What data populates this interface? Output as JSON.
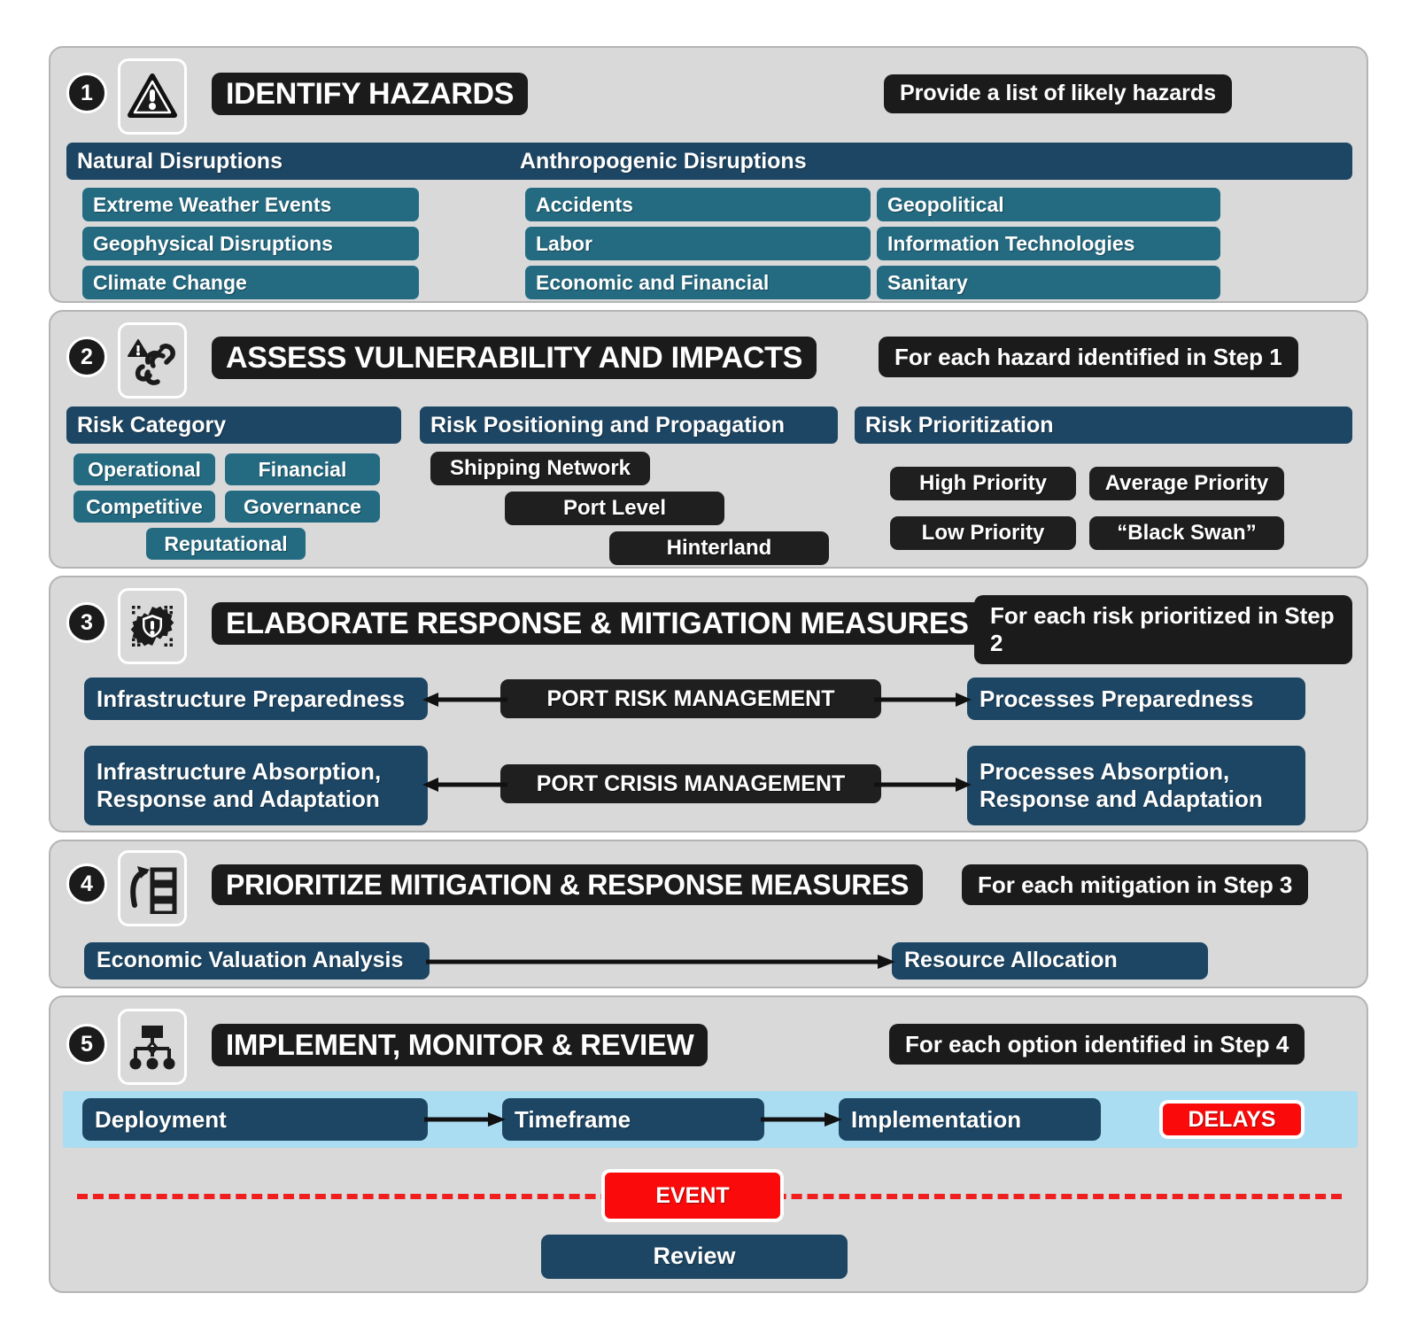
{
  "steps": [
    {
      "number": "1",
      "icon": "warning-triangle-icon",
      "title": "IDENTIFY HAZARDS",
      "note": "Provide a list of likely hazards",
      "groups": [
        {
          "header": "Natural Disruptions",
          "items": [
            "Extreme Weather Events",
            "Geophysical Disruptions",
            "Climate Change"
          ]
        },
        {
          "header": "Anthropogenic Disruptions",
          "items_col1": [
            "Accidents",
            "Labor",
            "Economic and Financial"
          ],
          "items_col2": [
            "Geopolitical",
            "Information Technologies",
            "Sanitary"
          ]
        }
      ]
    },
    {
      "number": "2",
      "icon": "broken-chain-warning-icon",
      "title": "ASSESS VULNERABILITY AND IMPACTS",
      "note": "For each hazard identified in Step 1",
      "risk_category": {
        "header": "Risk Category",
        "items": [
          "Operational",
          "Financial",
          "Competitive",
          "Governance",
          "Reputational"
        ]
      },
      "risk_positioning": {
        "header": "Risk Positioning and Propagation",
        "items": [
          "Shipping Network",
          "Port Level",
          "Hinterland"
        ]
      },
      "risk_prioritization": {
        "header": "Risk Prioritization",
        "items": [
          "High Priority",
          "Average Priority",
          "Low Priority",
          "“Black Swan”"
        ]
      }
    },
    {
      "number": "3",
      "icon": "gear-alert-icon",
      "title": "ELABORATE RESPONSE & MITIGATION MEASURES",
      "note": "For each risk prioritized in Step 2",
      "rows": [
        {
          "left": "Infrastructure Preparedness",
          "center": "PORT RISK MANAGEMENT",
          "right": "Processes Preparedness"
        },
        {
          "left": "Infrastructure Absorption, Response and Adaptation",
          "center": "PORT CRISIS MANAGEMENT",
          "right": "Processes Absorption, Response and Adaptation"
        }
      ]
    },
    {
      "number": "4",
      "icon": "prioritize-list-icon",
      "title": "PRIORITIZE MITIGATION & RESPONSE MEASURES",
      "note": "For each mitigation in Step 3",
      "flow": [
        "Economic Valuation Analysis",
        "Resource Allocation"
      ]
    },
    {
      "number": "5",
      "icon": "hierarchy-chart-icon",
      "title": "IMPLEMENT, MONITOR & REVIEW",
      "note": "For each option identified in Step 4",
      "timeline": [
        "Deployment",
        "Timeframe",
        "Implementation"
      ],
      "delays": "DELAYS",
      "event": "EVENT",
      "review": "Review"
    }
  ],
  "colors": {
    "panel_bg": "#d9d9d9",
    "navy": "#1d4664",
    "teal": "#246b82",
    "black": "#1f1f1f",
    "red": "#fa0a0a",
    "light_blue_band": "#aadcf2"
  }
}
